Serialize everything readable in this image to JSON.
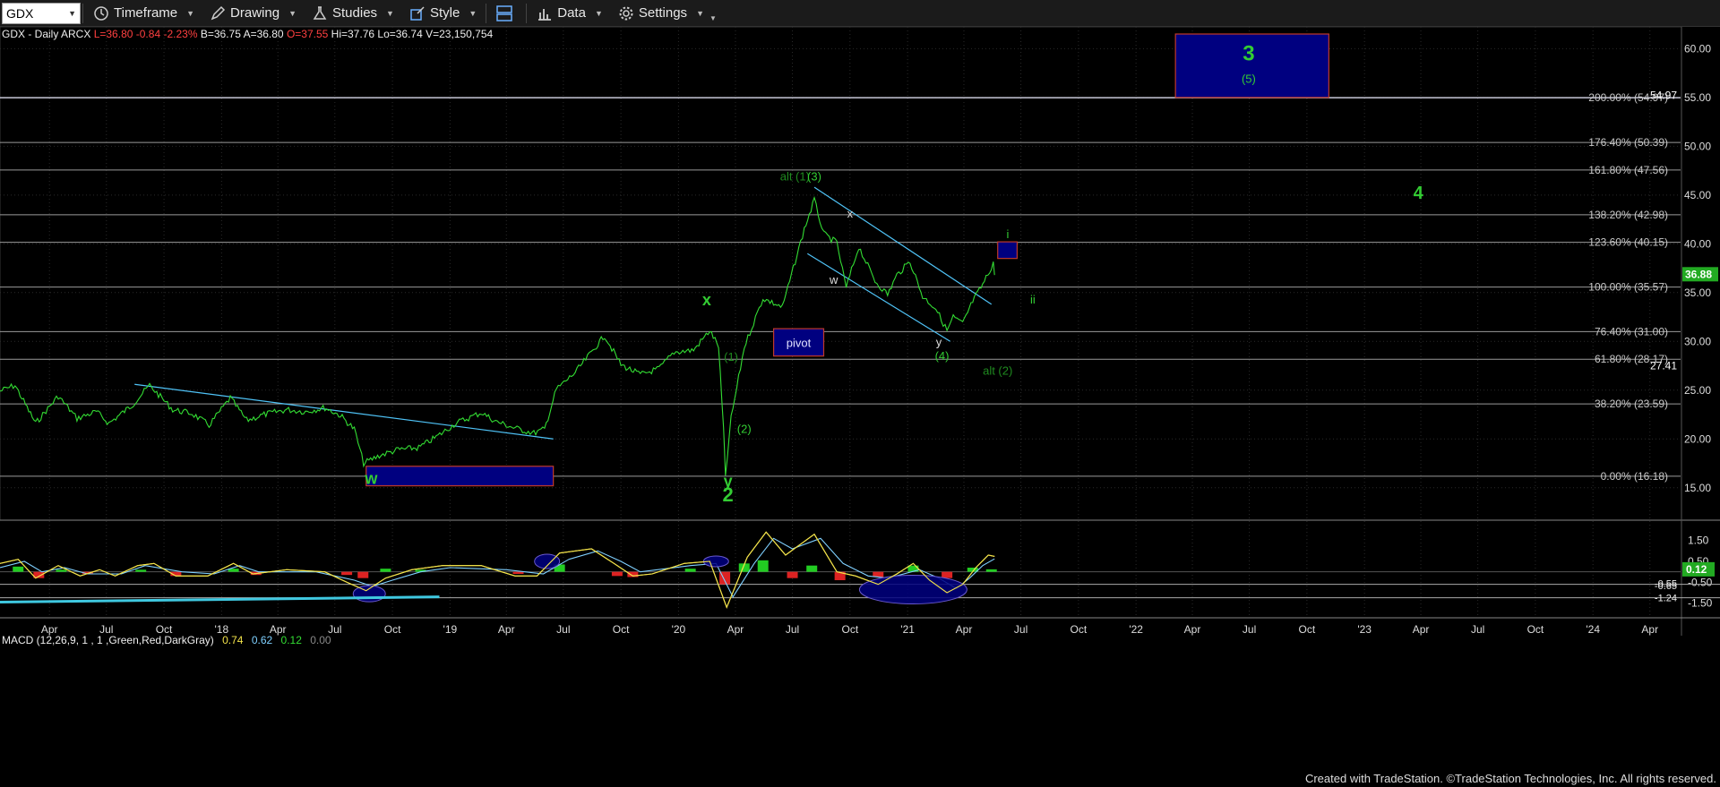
{
  "toolbar": {
    "symbol": "GDX",
    "timeframe_label": "Timeframe",
    "drawing_label": "Drawing",
    "studies_label": "Studies",
    "style_label": "Style",
    "data_label": "Data",
    "settings_label": "Settings"
  },
  "header": {
    "name": "GDX - Daily  ARCX",
    "last": "L=36.80",
    "change": "-0.84",
    "change_pct": "-2.23%",
    "bid": "B=36.75",
    "ask": "A=36.80",
    "open": "O=37.55",
    "high": "Hi=37.76",
    "low": "Lo=36.74",
    "volume": "V=23,150,754"
  },
  "macd_header": {
    "label": "MACD (12,26,9, 1 , 1 ,Green,Red,DarkGray)",
    "v1": "0.74",
    "v2": "0.62",
    "v3": "0.12",
    "v4": "0.00"
  },
  "footer": "Created with TradeStation. ©TradeStation Technologies, Inc. All rights reserved.",
  "colors": {
    "price": "#33dd33",
    "fib": "#9a9a9a",
    "box_fill": "#000080",
    "box_border": "#c0392b",
    "trend": "#4fc3f7",
    "label_green": "#33cc33",
    "dark_green": "#1f8a1f"
  },
  "chart_data": {
    "type": "line",
    "symbol": "GDX",
    "x_range": [
      "2017-01-12",
      "2024-05-20"
    ],
    "ylim": [
      12.5,
      61.5
    ],
    "y_ticks": [
      "60.00",
      "55.00",
      "50.00",
      "45.00",
      "40.00",
      "35.00",
      "30.00",
      "25.00",
      "20.00",
      "15.00"
    ],
    "x_ticks": [
      {
        "date": "2017-04-01",
        "label": "Apr"
      },
      {
        "date": "2017-07-01",
        "label": "Jul"
      },
      {
        "date": "2017-10-01",
        "label": "Oct"
      },
      {
        "date": "2018-01-01",
        "label": "'18"
      },
      {
        "date": "2018-04-01",
        "label": "Apr"
      },
      {
        "date": "2018-07-01",
        "label": "Jul"
      },
      {
        "date": "2018-10-01",
        "label": "Oct"
      },
      {
        "date": "2019-01-01",
        "label": "'19"
      },
      {
        "date": "2019-04-01",
        "label": "Apr"
      },
      {
        "date": "2019-07-01",
        "label": "Jul"
      },
      {
        "date": "2019-10-01",
        "label": "Oct"
      },
      {
        "date": "2020-01-01",
        "label": "'20"
      },
      {
        "date": "2020-04-01",
        "label": "Apr"
      },
      {
        "date": "2020-07-01",
        "label": "Jul"
      },
      {
        "date": "2020-10-01",
        "label": "Oct"
      },
      {
        "date": "2021-01-01",
        "label": "'21"
      },
      {
        "date": "2021-04-01",
        "label": "Apr"
      },
      {
        "date": "2021-07-01",
        "label": "Jul"
      },
      {
        "date": "2021-10-01",
        "label": "Oct"
      },
      {
        "date": "2022-01-01",
        "label": "'22"
      },
      {
        "date": "2022-04-01",
        "label": "Apr"
      },
      {
        "date": "2022-07-01",
        "label": "Jul"
      },
      {
        "date": "2022-10-01",
        "label": "Oct"
      },
      {
        "date": "2023-01-01",
        "label": "'23"
      },
      {
        "date": "2023-04-01",
        "label": "Apr"
      },
      {
        "date": "2023-07-01",
        "label": "Jul"
      },
      {
        "date": "2023-10-01",
        "label": "Oct"
      },
      {
        "date": "2024-01-01",
        "label": "'24"
      },
      {
        "date": "2024-04-01",
        "label": "Apr"
      }
    ],
    "price_series": {
      "name": "GDX",
      "points": [
        [
          "2017-01-12",
          24.9
        ],
        [
          "2017-02-05",
          25.5
        ],
        [
          "2017-03-10",
          21.6
        ],
        [
          "2017-04-15",
          24.4
        ],
        [
          "2017-05-15",
          22.1
        ],
        [
          "2017-06-15",
          22.8
        ],
        [
          "2017-07-05",
          21.6
        ],
        [
          "2017-08-10",
          23.4
        ],
        [
          "2017-09-08",
          25.5
        ],
        [
          "2017-10-15",
          23.0
        ],
        [
          "2017-11-15",
          22.6
        ],
        [
          "2017-12-12",
          21.4
        ],
        [
          "2018-01-15",
          24.2
        ],
        [
          "2018-02-10",
          21.9
        ],
        [
          "2018-03-10",
          22.5
        ],
        [
          "2018-04-15",
          23.0
        ],
        [
          "2018-05-15",
          22.8
        ],
        [
          "2018-06-15",
          23.2
        ],
        [
          "2018-07-10",
          22.4
        ],
        [
          "2018-08-01",
          21.0
        ],
        [
          "2018-08-16",
          17.5
        ],
        [
          "2018-09-10",
          18.3
        ],
        [
          "2018-10-10",
          18.9
        ],
        [
          "2018-11-12",
          19.1
        ],
        [
          "2018-12-10",
          20.2
        ],
        [
          "2019-01-10",
          21.6
        ],
        [
          "2019-02-20",
          22.7
        ],
        [
          "2019-03-15",
          21.8
        ],
        [
          "2019-04-15",
          21.1
        ],
        [
          "2019-05-15",
          20.6
        ],
        [
          "2019-06-01",
          21.0
        ],
        [
          "2019-06-20",
          25.1
        ],
        [
          "2019-07-20",
          26.8
        ],
        [
          "2019-08-20",
          29.3
        ],
        [
          "2019-09-05",
          30.6
        ],
        [
          "2019-10-01",
          27.6
        ],
        [
          "2019-11-01",
          26.6
        ],
        [
          "2019-12-01",
          27.2
        ],
        [
          "2019-12-25",
          28.9
        ],
        [
          "2020-01-25",
          29.1
        ],
        [
          "2020-02-20",
          31.1
        ],
        [
          "2020-03-05",
          29.5
        ],
        [
          "2020-03-13",
          21.0
        ],
        [
          "2020-03-16",
          16.2
        ],
        [
          "2020-03-25",
          22.1
        ],
        [
          "2020-04-15",
          29.4
        ],
        [
          "2020-05-15",
          34.4
        ],
        [
          "2020-06-15",
          33.5
        ],
        [
          "2020-07-20",
          41.5
        ],
        [
          "2020-08-05",
          44.5
        ],
        [
          "2020-08-20",
          41.0
        ],
        [
          "2020-09-10",
          40.1
        ],
        [
          "2020-09-25",
          35.5
        ],
        [
          "2020-10-15",
          39.7
        ],
        [
          "2020-11-10",
          36.2
        ],
        [
          "2020-11-30",
          34.8
        ],
        [
          "2020-12-15",
          36.8
        ],
        [
          "2021-01-05",
          38.2
        ],
        [
          "2021-01-25",
          34.6
        ],
        [
          "2021-02-15",
          33.4
        ],
        [
          "2021-03-05",
          31.1
        ],
        [
          "2021-03-15",
          32.5
        ],
        [
          "2021-03-30",
          31.8
        ],
        [
          "2021-04-15",
          34.1
        ],
        [
          "2021-05-01",
          35.8
        ],
        [
          "2021-05-12",
          37.2
        ],
        [
          "2021-05-18",
          38.1
        ],
        [
          "2021-05-20",
          36.8
        ]
      ]
    },
    "fib_levels": [
      {
        "label": "200.00% (54.97)",
        "value": 54.97
      },
      {
        "label": "176.40% (50.39)",
        "value": 50.39
      },
      {
        "label": "161.80% (47.56)",
        "value": 47.56
      },
      {
        "label": "138.20% (42.98)",
        "value": 42.98
      },
      {
        "label": "123.60% (40.15)",
        "value": 40.15
      },
      {
        "label": "100.00% (35.57)",
        "value": 35.57
      },
      {
        "label": "76.40% (31.00)",
        "value": 31.0
      },
      {
        "label": "61.80% (28.17)",
        "value": 28.17
      },
      {
        "label": "38.20% (23.59)",
        "value": 23.59
      },
      {
        "label": "0.00% (16.18)",
        "value": 16.18
      }
    ],
    "price_axis_markers": [
      {
        "label": "54.97",
        "value": 55.2
      },
      {
        "label": "27.41",
        "value": 27.5
      },
      {
        "label": "36.88",
        "value": 36.88
      }
    ],
    "boxes": [
      {
        "label": "",
        "x1": "2022-03-05",
        "x2": "2022-11-05",
        "y1": 55.0,
        "y2": 61.5
      },
      {
        "label": "",
        "x1": "2021-05-25",
        "x2": "2021-06-25",
        "y1": 38.5,
        "y2": 40.2
      },
      {
        "label": "pivot",
        "x1": "2020-06-01",
        "x2": "2020-08-20",
        "y1": 28.5,
        "y2": 31.3
      },
      {
        "label": "",
        "x1": "2018-08-20",
        "x2": "2019-06-15",
        "y1": 15.2,
        "y2": 17.2
      }
    ],
    "trendlines": [
      {
        "x1": "2017-08-15",
        "y1": 25.6,
        "x2": "2019-06-15",
        "y2": 20.0
      },
      {
        "x1": "2020-08-05",
        "y1": 45.8,
        "x2": "2021-05-15",
        "y2": 33.8
      },
      {
        "x1": "2020-07-25",
        "y1": 39.0,
        "x2": "2021-03-10",
        "y2": 30.0
      }
    ],
    "annotations": [
      {
        "text": "3",
        "x": "2022-06-30",
        "y": 58.8,
        "size": 24,
        "weight": "bold",
        "color": "label_green"
      },
      {
        "text": "(5)",
        "x": "2022-06-30",
        "y": 56.5,
        "size": 13,
        "weight": "normal",
        "color": "label_green"
      },
      {
        "text": "4",
        "x": "2023-03-28",
        "y": 44.6,
        "size": 20,
        "weight": "bold",
        "color": "label_green"
      },
      {
        "text": "alt (1)",
        "x": "2020-07-05",
        "y": 46.5,
        "size": 13,
        "weight": "normal",
        "color": "dark_green"
      },
      {
        "text": "(3)",
        "x": "2020-08-05",
        "y": 46.5,
        "size": 13,
        "weight": "normal",
        "color": "label_green"
      },
      {
        "text": "x",
        "x": "2020-10-01",
        "y": 42.7,
        "size": 13,
        "weight": "normal",
        "color": "#dddddd"
      },
      {
        "text": "i",
        "x": "2021-06-10",
        "y": 40.6,
        "size": 13,
        "weight": "normal",
        "color": "label_green"
      },
      {
        "text": "w",
        "x": "2020-09-05",
        "y": 35.9,
        "size": 13,
        "weight": "normal",
        "color": "#dddddd"
      },
      {
        "text": "ii",
        "x": "2021-07-20",
        "y": 33.9,
        "size": 13,
        "weight": "normal",
        "color": "label_green"
      },
      {
        "text": "x",
        "x": "2020-02-15",
        "y": 33.7,
        "size": 18,
        "weight": "bold",
        "color": "label_green"
      },
      {
        "text": "y",
        "x": "2021-02-20",
        "y": 29.5,
        "size": 13,
        "weight": "normal",
        "color": "#dddddd"
      },
      {
        "text": "(4)",
        "x": "2021-02-25",
        "y": 28.1,
        "size": 13,
        "weight": "normal",
        "color": "label_green"
      },
      {
        "text": "(1)",
        "x": "2020-03-25",
        "y": 28.0,
        "size": 13,
        "weight": "normal",
        "color": "dark_green"
      },
      {
        "text": "alt (2)",
        "x": "2021-05-25",
        "y": 26.6,
        "size": 13,
        "weight": "normal",
        "color": "dark_green"
      },
      {
        "text": "(2)",
        "x": "2020-04-15",
        "y": 20.6,
        "size": 13,
        "weight": "normal",
        "color": "label_green"
      },
      {
        "text": "w",
        "x": "2018-08-28",
        "y": 15.4,
        "size": 18,
        "weight": "bold",
        "color": "label_green"
      },
      {
        "text": "y",
        "x": "2020-03-20",
        "y": 15.1,
        "size": 18,
        "weight": "bold",
        "color": "label_green"
      },
      {
        "text": "2",
        "x": "2020-03-20",
        "y": 13.6,
        "size": 22,
        "weight": "bold",
        "color": "label_green"
      }
    ],
    "macd": {
      "ylim": [
        -1.9,
        2.0
      ],
      "y_ticks": [
        "1.50",
        "0.50",
        "-0.50",
        "-1.50"
      ],
      "value_markers": [
        {
          "label": "0.12",
          "value": 0.12,
          "box": true
        },
        {
          "label": "-0.55",
          "value": -0.55
        },
        {
          "label": "-0.65",
          "value": -0.65
        },
        {
          "label": "-1.24",
          "value": -1.24
        }
      ],
      "macd_line": [
        [
          "2017-01-12",
          0.4
        ],
        [
          "2017-02-10",
          0.6
        ],
        [
          "2017-03-10",
          -0.3
        ],
        [
          "2017-04-15",
          0.3
        ],
        [
          "2017-05-20",
          -0.2
        ],
        [
          "2017-06-20",
          0.1
        ],
        [
          "2017-07-15",
          -0.2
        ],
        [
          "2017-08-20",
          0.3
        ],
        [
          "2017-09-15",
          0.4
        ],
        [
          "2017-10-20",
          -0.2
        ],
        [
          "2017-12-10",
          -0.2
        ],
        [
          "2018-01-20",
          0.4
        ],
        [
          "2018-02-20",
          -0.1
        ],
        [
          "2018-04-15",
          0.1
        ],
        [
          "2018-06-15",
          0.0
        ],
        [
          "2018-07-20",
          -0.5
        ],
        [
          "2018-08-20",
          -0.9
        ],
        [
          "2018-09-20",
          -0.3
        ],
        [
          "2018-11-01",
          0.1
        ],
        [
          "2018-12-20",
          0.3
        ],
        [
          "2019-02-20",
          0.3
        ],
        [
          "2019-04-15",
          -0.2
        ],
        [
          "2019-05-20",
          -0.2
        ],
        [
          "2019-06-25",
          0.9
        ],
        [
          "2019-08-15",
          1.1
        ],
        [
          "2019-09-20",
          0.4
        ],
        [
          "2019-10-20",
          -0.2
        ],
        [
          "2019-11-20",
          -0.1
        ],
        [
          "2020-01-10",
          0.4
        ],
        [
          "2020-02-20",
          0.5
        ],
        [
          "2020-03-18",
          -1.7
        ],
        [
          "2020-04-20",
          0.7
        ],
        [
          "2020-05-20",
          1.9
        ],
        [
          "2020-06-20",
          0.8
        ],
        [
          "2020-08-05",
          1.8
        ],
        [
          "2020-09-10",
          0.0
        ],
        [
          "2020-10-10",
          -0.2
        ],
        [
          "2020-11-15",
          -0.6
        ],
        [
          "2020-12-15",
          -0.1
        ],
        [
          "2021-01-10",
          0.4
        ],
        [
          "2021-02-05",
          -0.4
        ],
        [
          "2021-03-05",
          -1.0
        ],
        [
          "2021-03-30",
          -0.6
        ],
        [
          "2021-04-20",
          0.2
        ],
        [
          "2021-05-10",
          0.8
        ],
        [
          "2021-05-20",
          0.74
        ]
      ],
      "signal_line": [
        [
          "2017-01-12",
          0.2
        ],
        [
          "2017-02-20",
          0.5
        ],
        [
          "2017-03-20",
          0.0
        ],
        [
          "2017-04-25",
          0.2
        ],
        [
          "2017-06-01",
          -0.1
        ],
        [
          "2017-07-25",
          -0.1
        ],
        [
          "2017-09-01",
          0.3
        ],
        [
          "2017-10-30",
          0.0
        ],
        [
          "2017-12-20",
          -0.1
        ],
        [
          "2018-01-30",
          0.3
        ],
        [
          "2018-03-01",
          0.0
        ],
        [
          "2018-06-01",
          0.0
        ],
        [
          "2018-08-01",
          -0.4
        ],
        [
          "2018-08-30",
          -0.7
        ],
        [
          "2018-10-01",
          -0.4
        ],
        [
          "2018-11-15",
          0.0
        ],
        [
          "2019-01-01",
          0.2
        ],
        [
          "2019-04-01",
          0.1
        ],
        [
          "2019-05-30",
          -0.1
        ],
        [
          "2019-07-10",
          0.6
        ],
        [
          "2019-08-25",
          1.0
        ],
        [
          "2019-10-01",
          0.5
        ],
        [
          "2019-11-01",
          0.0
        ],
        [
          "2020-01-20",
          0.3
        ],
        [
          "2020-03-01",
          0.4
        ],
        [
          "2020-03-28",
          -1.2
        ],
        [
          "2020-05-01",
          0.4
        ],
        [
          "2020-06-01",
          1.6
        ],
        [
          "2020-07-01",
          1.1
        ],
        [
          "2020-08-15",
          1.6
        ],
        [
          "2020-09-20",
          0.4
        ],
        [
          "2020-10-30",
          -0.2
        ],
        [
          "2020-12-01",
          -0.3
        ],
        [
          "2021-01-20",
          0.1
        ],
        [
          "2021-02-20",
          -0.3
        ],
        [
          "2021-03-20",
          -0.8
        ],
        [
          "2021-04-10",
          -0.3
        ],
        [
          "2021-05-01",
          0.3
        ],
        [
          "2021-05-20",
          0.62
        ]
      ],
      "histogram": [
        [
          "2017-02-10",
          0.25
        ],
        [
          "2017-03-15",
          -0.3
        ],
        [
          "2017-04-20",
          0.1
        ],
        [
          "2017-06-01",
          -0.1
        ],
        [
          "2017-08-25",
          0.1
        ],
        [
          "2017-10-20",
          -0.2
        ],
        [
          "2018-01-20",
          0.15
        ],
        [
          "2018-02-25",
          -0.15
        ],
        [
          "2018-07-20",
          -0.15
        ],
        [
          "2018-08-15",
          -0.3
        ],
        [
          "2018-09-20",
          0.15
        ],
        [
          "2018-11-15",
          0.1
        ],
        [
          "2019-04-20",
          -0.1
        ],
        [
          "2019-06-25",
          0.35
        ],
        [
          "2019-09-25",
          -0.2
        ],
        [
          "2019-10-20",
          -0.25
        ],
        [
          "2020-01-20",
          0.15
        ],
        [
          "2020-03-15",
          -0.6
        ],
        [
          "2020-04-15",
          0.4
        ],
        [
          "2020-05-15",
          0.55
        ],
        [
          "2020-07-01",
          -0.3
        ],
        [
          "2020-08-01",
          0.3
        ],
        [
          "2020-09-15",
          -0.4
        ],
        [
          "2020-11-15",
          -0.25
        ],
        [
          "2021-01-10",
          0.3
        ],
        [
          "2021-03-05",
          -0.3
        ],
        [
          "2021-04-15",
          0.2
        ],
        [
          "2021-05-15",
          0.12
        ]
      ]
    }
  }
}
